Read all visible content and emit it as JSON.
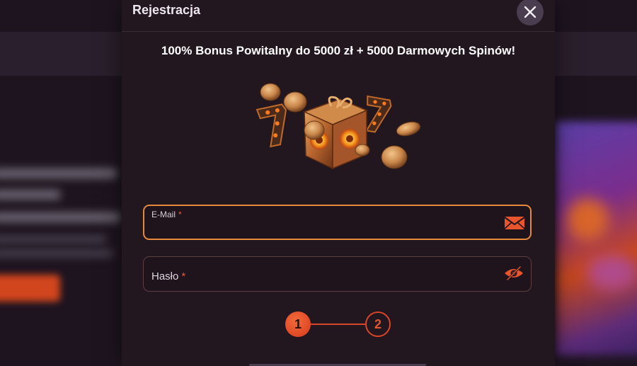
{
  "modal": {
    "title": "Rejestracja",
    "close_icon": "close-icon",
    "headline": "100% Bonus Powitalny do 5000 zł + 5000 Darmowych Spinów!",
    "promo_image": "gift-box-coins-sevens-illustration"
  },
  "form": {
    "email": {
      "label": "E-Mail",
      "required_mark": "*",
      "value": "",
      "icon": "envelope-icon"
    },
    "password": {
      "label": "Hasło",
      "required_mark": "*",
      "value": "",
      "icon": "hide-password-eye-icon"
    }
  },
  "steps": {
    "items": [
      "1",
      "2"
    ],
    "current": 1
  },
  "colors": {
    "accent": "#e0562f",
    "focus_border": "#e58a3c",
    "modal_bg": "#22161f"
  }
}
